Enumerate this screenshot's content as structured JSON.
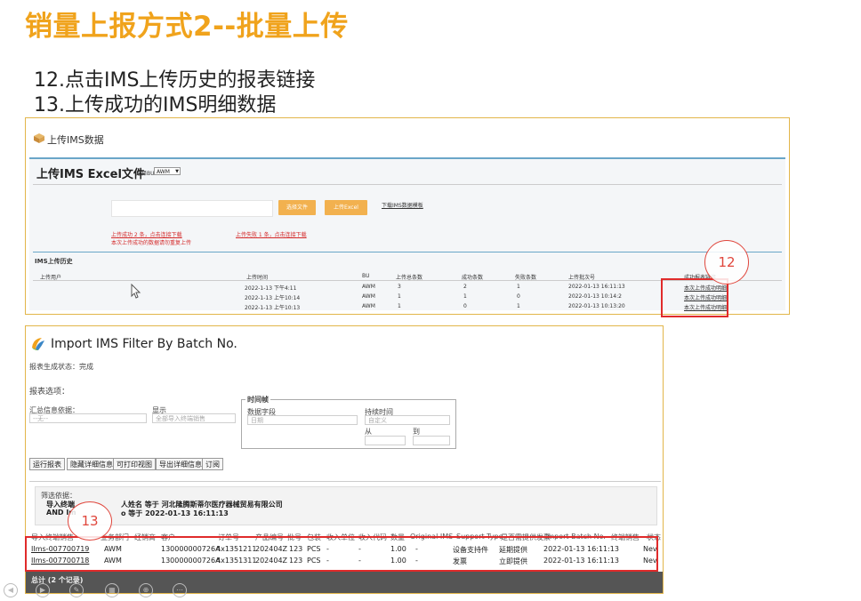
{
  "slide": {
    "title": "销量上报方式2--批量上传",
    "step12": "12.点击IMS上传历史的报表链接",
    "step13": "13.上传成功的IMS明细数据"
  },
  "upload_page": {
    "header_title": "上传IMS数据",
    "section_title": "上传IMS Excel文件",
    "bu_label": "选择BU",
    "bu_value": "AWM",
    "choose_file_button": "选择文件",
    "upload_button": "上传Excel",
    "download_template_link": "下载IMS数据模板",
    "success_line1": "上传成功 2 条，点击连接下载",
    "success_line2": "本次上传成功的数据请勿重复上传",
    "fail_line": "上传失败 1 条，点击连接下载",
    "history_title": "IMS上传历史",
    "history_columns": [
      "上传用户",
      "上传时间",
      "BU",
      "上传总条数",
      "成功条数",
      "失败条数",
      "上传批次号",
      "成功报表链接"
    ],
    "history_rows": [
      {
        "time": "2022-1-13 下午4:11",
        "bu": "AWM",
        "total": "3",
        "success": "2",
        "fail": "1",
        "batch": "2022-01-13 16:11:13",
        "link": "本次上传成功明细"
      },
      {
        "time": "2022-1-13 上午10:14",
        "bu": "AWM",
        "total": "1",
        "success": "1",
        "fail": "0",
        "batch": "2022-01-13 10:14:2",
        "link": "本次上传成功明细"
      },
      {
        "time": "2022-1-13 上午10:13",
        "bu": "AWM",
        "total": "1",
        "success": "0",
        "fail": "1",
        "batch": "2022-01-13 10:13:20",
        "link": "本次上传成功明细"
      }
    ],
    "callout": "12"
  },
  "report_page": {
    "title": "Import IMS Filter By Batch No.",
    "status_label": "报表生成状态：",
    "status_value": "完成",
    "options_label": "报表选项：",
    "summary_label": "汇总信息依据：",
    "summary_value": "--无--",
    "show_label": "显示",
    "show_value": "全部导入终端销售",
    "time_frame_label": "时间帧",
    "date_field_label": "数据字段",
    "date_field_value": "日期",
    "duration_label": "持续时间",
    "duration_value": "自定义",
    "from_label": "从",
    "to_label": "到",
    "buttons": [
      "运行报表",
      "隐藏详细信息",
      "可打印视图",
      "导出详细信息",
      "订阅"
    ],
    "filter_label": "筛选依据：",
    "filter_line1_a": "导入终端",
    "filter_line1_b": "人姓名 等于 河北隆腾斯蒂尔医疗器械贸易有限公司",
    "filter_line2_a": "AND Im",
    "filter_line2_b": "o 等于 2022-01-13 16:11:13",
    "columns": [
      "导入终端销售",
      "业务部门",
      "经销商",
      "客户",
      "订单号",
      "产品编号",
      "批号",
      "包装",
      "收入单位",
      "收入代码",
      "数量",
      "Original IMS",
      "Support Type",
      "是否需提供发票",
      "Import Batch No.",
      "终端销售",
      "状态"
    ],
    "rows": [
      {
        "id": "IIms-007700719",
        "dept": "AWM",
        "customer": "130000000726A",
        "order": "4x1351211",
        "product": "202404Z",
        "batch": "123",
        "pack": "PCS",
        "unit": "-",
        "code": "-",
        "qty": "1.00",
        "orig": "-",
        "support": "设备支持件",
        "invoice": "延期提供",
        "import_batch": "2022-01-13 16:11:13",
        "status": "Nev"
      },
      {
        "id": "IIms-007700718",
        "dept": "AWM",
        "customer": "130000000726A",
        "order": "4x1351311",
        "product": "202404Z",
        "batch": "123",
        "pack": "PCS",
        "unit": "-",
        "code": "-",
        "qty": "1.00",
        "orig": "-",
        "support": "发票",
        "invoice": "立即提供",
        "import_batch": "2022-01-13 16:11:13",
        "status": "Nev"
      }
    ],
    "total_label": "总计 (2 个记录)",
    "callout": "13"
  },
  "colors": {
    "title": "#f0a31c",
    "highlight": "#e02b2b",
    "header_bar": "#6aa6c8",
    "button_orange": "#f2b14f"
  }
}
